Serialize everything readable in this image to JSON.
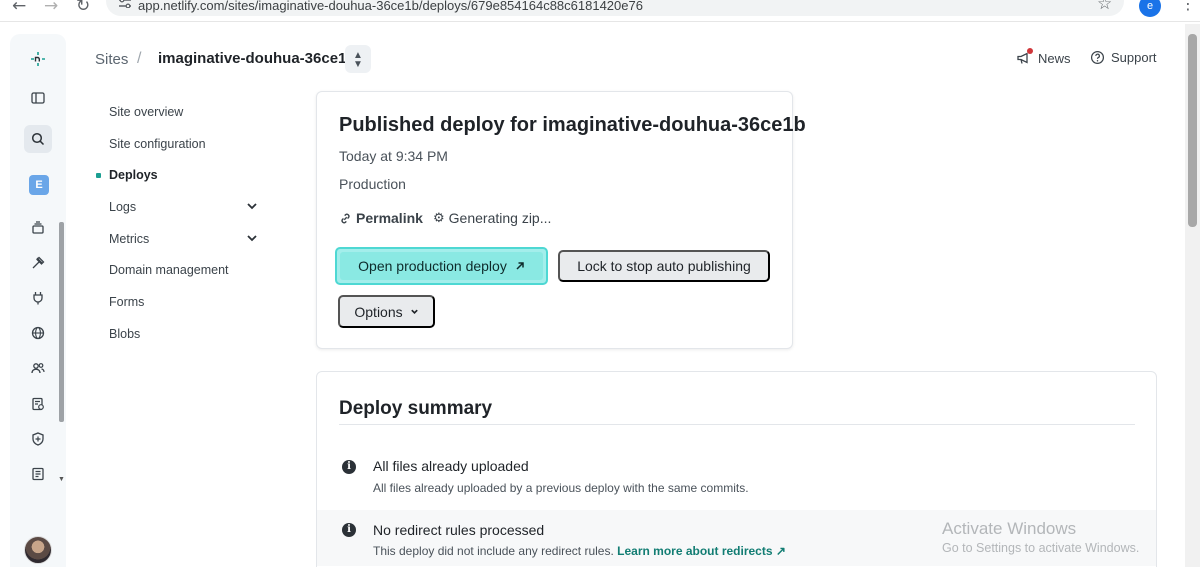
{
  "browser": {
    "url": "app.netlify.com/sites/imaginative-douhua-36ce1b/deploys/679e854164c88c6181420e76",
    "profile_initial": "e"
  },
  "rail": {
    "team_initial": "E"
  },
  "breadcrumb": {
    "root": "Sites",
    "separator": "/",
    "site": "imaginative-douhua-36ce1b"
  },
  "header_links": {
    "news": "News",
    "support": "Support"
  },
  "subnav": {
    "items": [
      {
        "label": "Site overview"
      },
      {
        "label": "Site configuration"
      },
      {
        "label": "Deploys"
      },
      {
        "label": "Logs"
      },
      {
        "label": "Metrics"
      },
      {
        "label": "Domain management"
      },
      {
        "label": "Forms"
      },
      {
        "label": "Blobs"
      }
    ]
  },
  "deploy": {
    "title": "Published deploy for imaginative-douhua-36ce1b",
    "time": "Today at 9:34 PM",
    "context": "Production",
    "permalink": "Permalink",
    "zip_status": "Generating zip...",
    "open_button": "Open production deploy",
    "lock_button": "Lock to stop auto publishing",
    "options_button": "Options"
  },
  "summary": {
    "title": "Deploy summary",
    "rows": [
      {
        "heading": "All files already uploaded",
        "desc": "All files already uploaded by a previous deploy with the same commits."
      },
      {
        "heading": "No redirect rules processed",
        "desc": "This deploy did not include any redirect rules.",
        "link": "Learn more about redirects"
      }
    ]
  },
  "watermark": {
    "title": "Activate Windows",
    "subtitle": "Go to Settings to activate Windows."
  },
  "colors": {
    "accent_teal": "#1b9f92",
    "primary_button": "#8ae9e3",
    "primary_border": "#4ed8d3",
    "link": "#127d73"
  }
}
